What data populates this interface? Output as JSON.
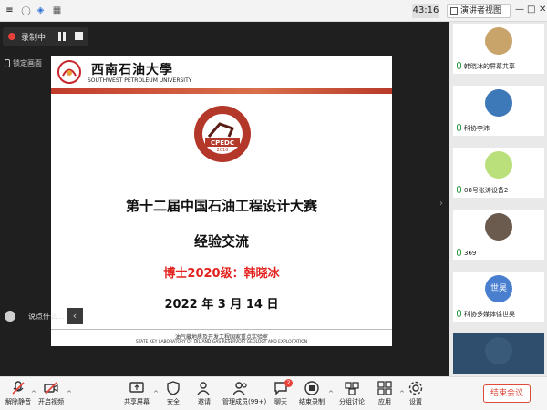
{
  "topbar": {
    "timer": "43:16",
    "view_label": "演讲者视图",
    "minimize": "—",
    "maximize": "□",
    "close": "✕"
  },
  "recording": {
    "label": "录制中"
  },
  "lock_screen": "锁定画面",
  "slide": {
    "university_cn": "西南石油大學",
    "university_en": "SOUTHWEST PETROLEUM UNIVERSITY",
    "seal_text": "CPEDC",
    "seal_year": "2010",
    "title_line1": "第十二届中国石油工程设计大赛",
    "title_line2": "经验交流",
    "presenter": "博士2020级：韩晓冰",
    "date": "2022 年 3 月 14 日",
    "footer_cn": "油气藏地质及开发工程国家重点实验室",
    "footer_en": "STATE KEY LABORATORY OF OIL AND GAS RESERVOIR GEOLOGY AND EXPLOITATION"
  },
  "chat": {
    "placeholder": "说点什么...",
    "toggle": "‹"
  },
  "participants": [
    {
      "name": "韩晓冰的屏幕共享",
      "avatar_color": "#c8a46a"
    },
    {
      "name": "科协李沛",
      "avatar_color": "#3d78b8"
    },
    {
      "name": "08号张涛设备2",
      "avatar_color": "#b9e07a"
    },
    {
      "name": "369",
      "avatar_color": "#6b5a4e"
    },
    {
      "name": "科协多媒体徐世昊",
      "avatar_color": "#4a7fcf",
      "avatar_text": "世昊"
    },
    {
      "name": "",
      "avatar_color": "#3a5a7a"
    }
  ],
  "toolbar": {
    "mute": "解除静音",
    "video": "开启视频",
    "share": "共享屏幕",
    "security": "安全",
    "invite": "邀请",
    "members": "管理成员(99+)",
    "chat": "聊天",
    "chat_badge": "2",
    "record": "结束录制",
    "breakout": "分组讨论",
    "apps": "应用",
    "settings": "设置",
    "end": "结束会议"
  }
}
